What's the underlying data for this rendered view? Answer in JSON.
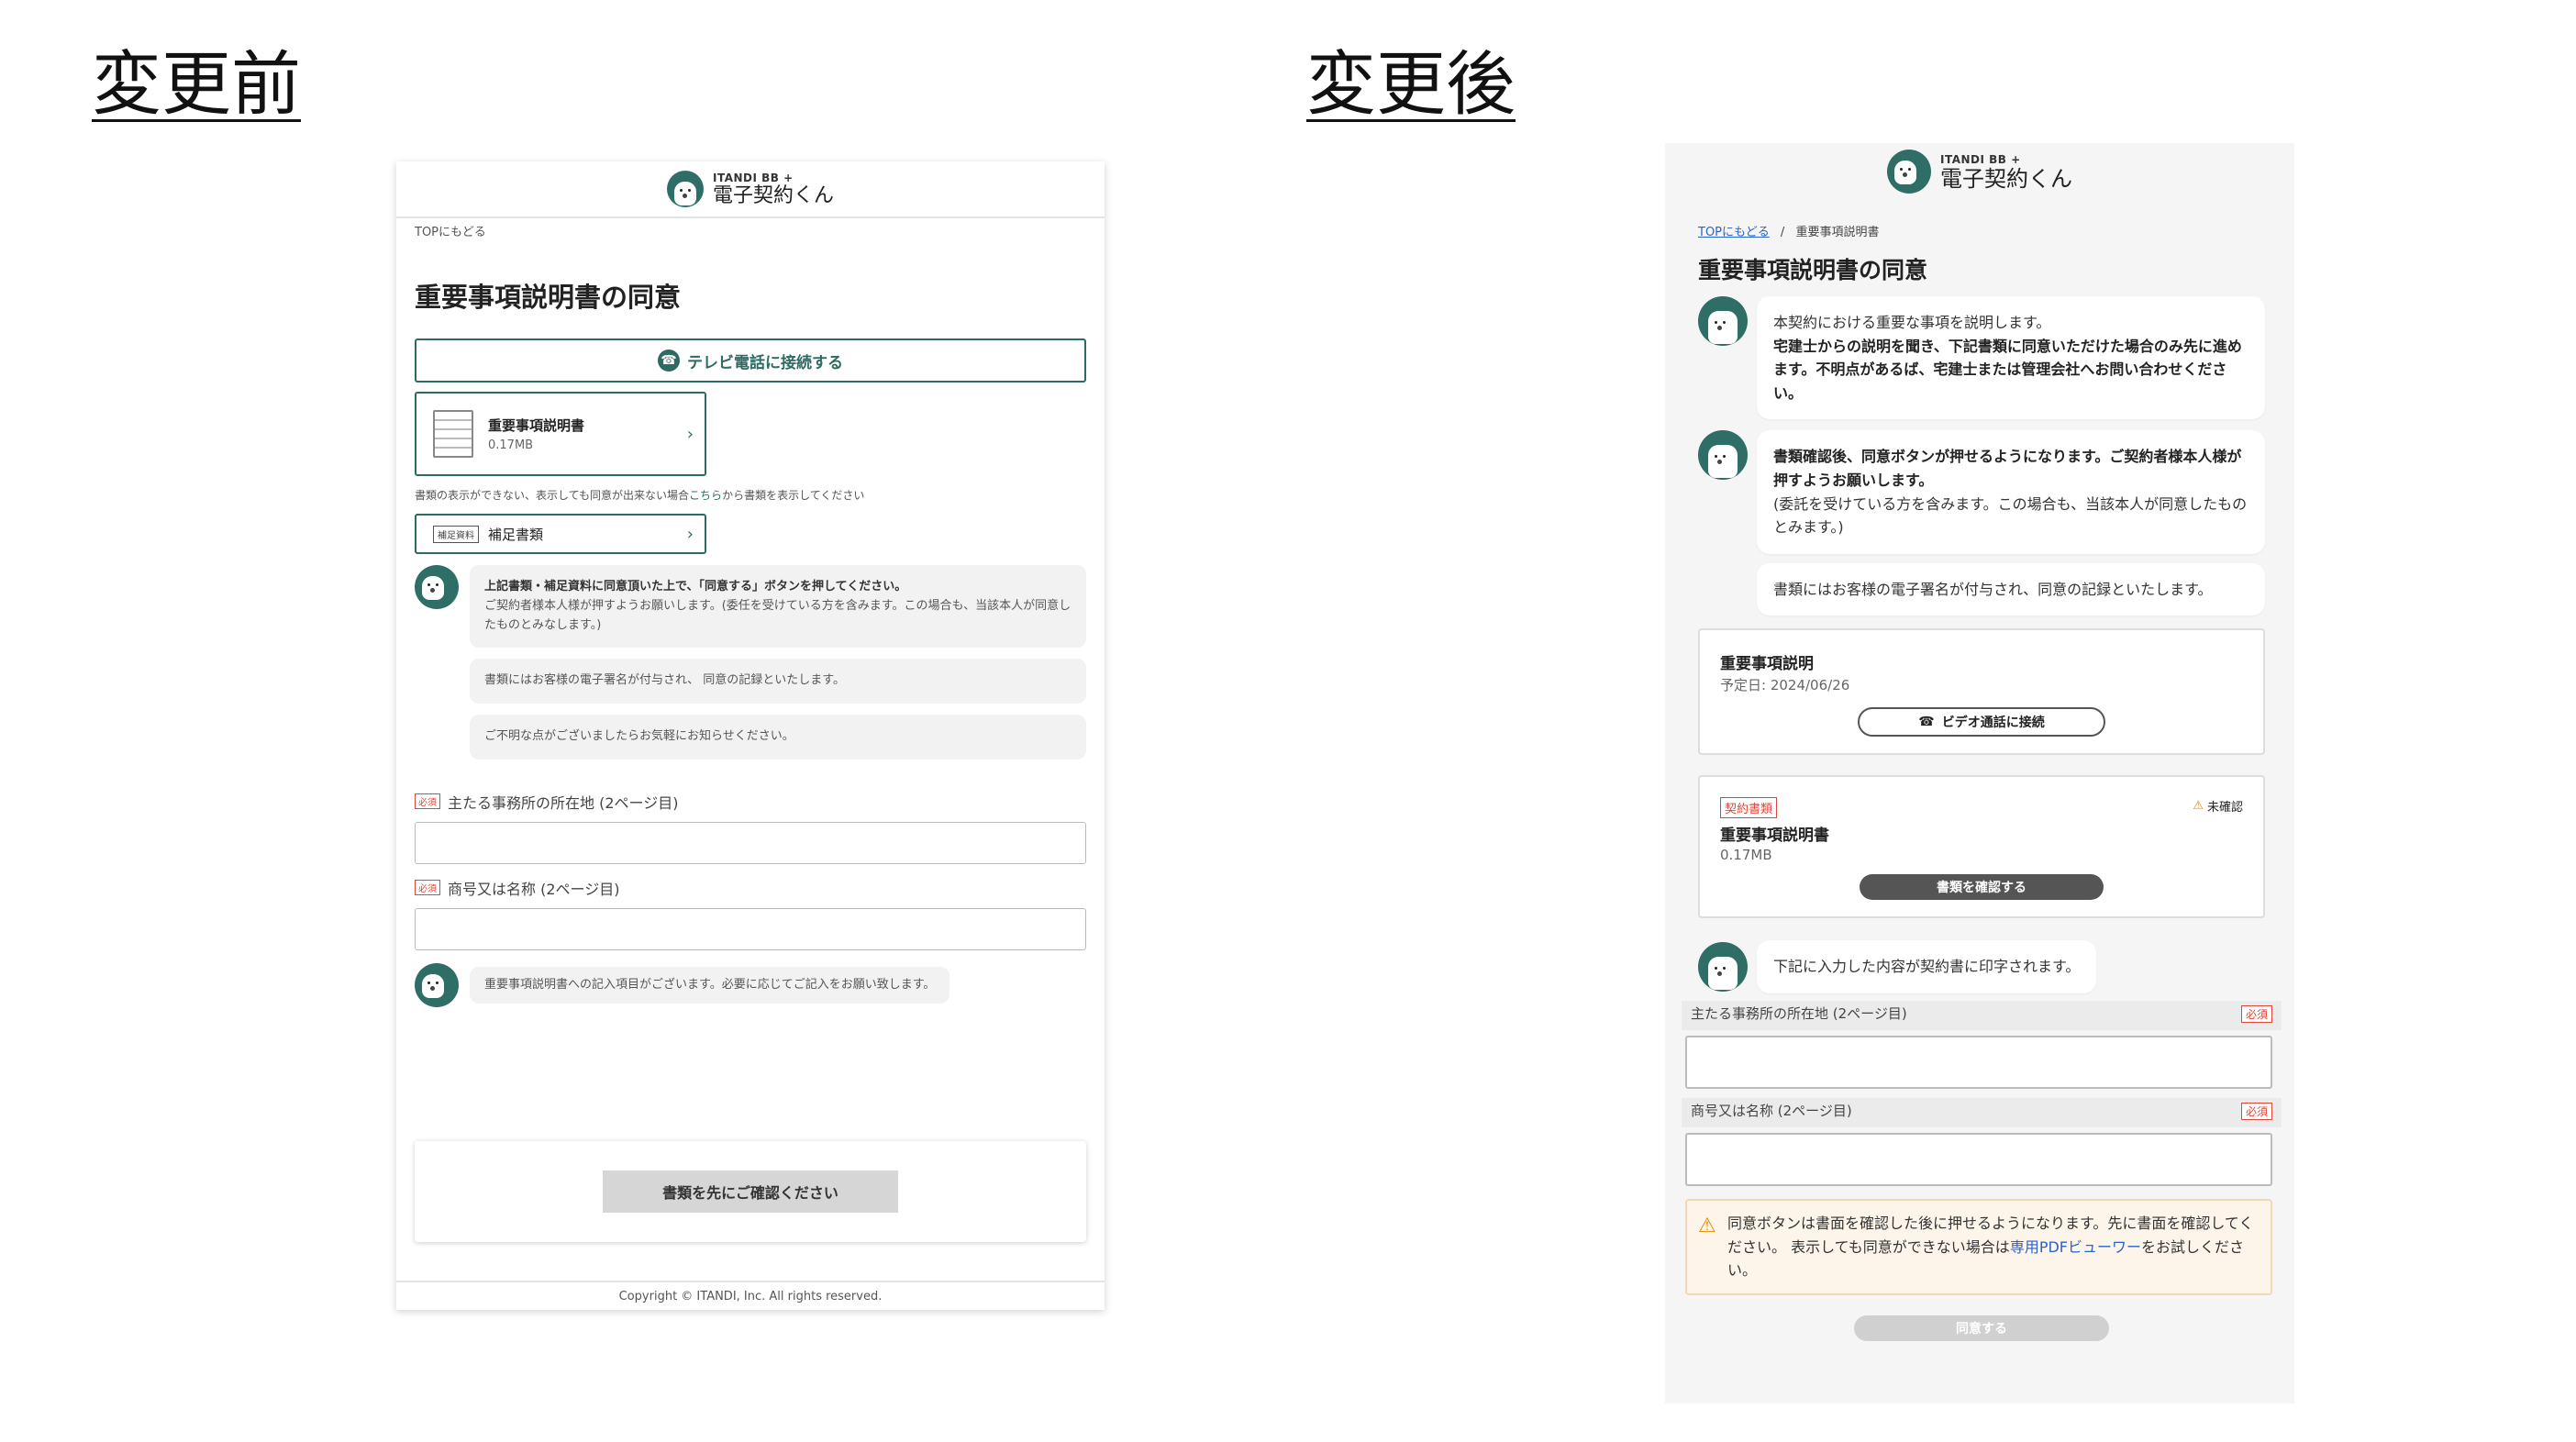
{
  "labels": {
    "before": "変更前",
    "after": "変更後"
  },
  "logo": {
    "small": "ITANDI BB +",
    "main": "電子契約くん"
  },
  "before": {
    "breadcrumb": "TOPにもどる",
    "title": "重要事項説明書の同意",
    "tv_button": "テレビ電話に接続する",
    "document": {
      "name": "重要事項説明書",
      "size": "0.17MB"
    },
    "note_prefix": "書類の表示ができない、表示しても同意が出来ない場合",
    "note_link": "こちら",
    "note_suffix": "から書類を表示してください",
    "supplement": {
      "tag": "補足資料",
      "label": "補足書類"
    },
    "chat1_bold": "上記書類・補足資料に同意頂いた上で、「同意する」ボタンを押してください。",
    "chat1_text": "ご契約者様本人様が押すようお願いします。(委任を受けている方を含みます。この場合も、当該本人が同意したものとみなします。)",
    "chat2": "書類にはお客様の電子署名が付与され、 同意の記録といたします。",
    "chat3": "ご不明な点がございましたらお気軽にお知らせください。",
    "required_tag": "必須",
    "field1_label": "主たる事務所の所在地 (2ページ目)",
    "field2_label": "商号又は名称 (2ページ目)",
    "chat4": "重要事項説明書への記入項目がございます。必要に応じてご記入をお願い致します。",
    "confirm_button": "書類を先にご確認ください",
    "copyright": "Copyright © ITANDI, Inc. All rights reserved."
  },
  "after": {
    "breadcrumb_link": "TOPにもどる",
    "breadcrumb_sep": "/",
    "breadcrumb_current": "重要事項説明書",
    "title": "重要事項説明書の同意",
    "msg1_text": "本契約における重要な事項を説明します。",
    "msg1_bold": "宅建士からの説明を聞き、下記書類に同意いただけた場合のみ先に進めます。不明点があるば、宅建士または管理会社へお問い合わせください。",
    "msg2_bold": "書類確認後、同意ボタンが押せるようになります。ご契約者様本人様が押すようお願いします。",
    "msg2_text": "(委託を受けている方を含みます。この場合も、当該本人が同意したものとみます。)",
    "msg3": "書類にはお客様の電子署名が付与され、同意の記録といたします。",
    "explain_card": {
      "title": "重要事項説明",
      "date": "予定日: 2024/06/26",
      "button": "ビデオ通話に接続"
    },
    "doc_card": {
      "tag": "契約書類",
      "status": "未確認",
      "name": "重要事項説明書",
      "size": "0.17MB",
      "button": "書類を確認する"
    },
    "msg4": "下記に入力した内容が契約書に印字されます。",
    "field1_label": "主たる事務所の所在地 (2ページ目)",
    "field2_label": "商号又は名称 (2ページ目)",
    "required_tag": "必須",
    "warning_text": "同意ボタンは書面を確認した後に押せるようになります。先に書面を確認してください。 表示しても同意ができない場合は",
    "warning_link": "専用PDFビューワー",
    "warning_suffix": "をお試しください。",
    "agree_button": "同意する"
  },
  "colors": {
    "brand_green": "#2d6b62",
    "required_red": "#e0463c",
    "link_blue": "#2a64c8",
    "warning_orange": "#e88a00"
  }
}
